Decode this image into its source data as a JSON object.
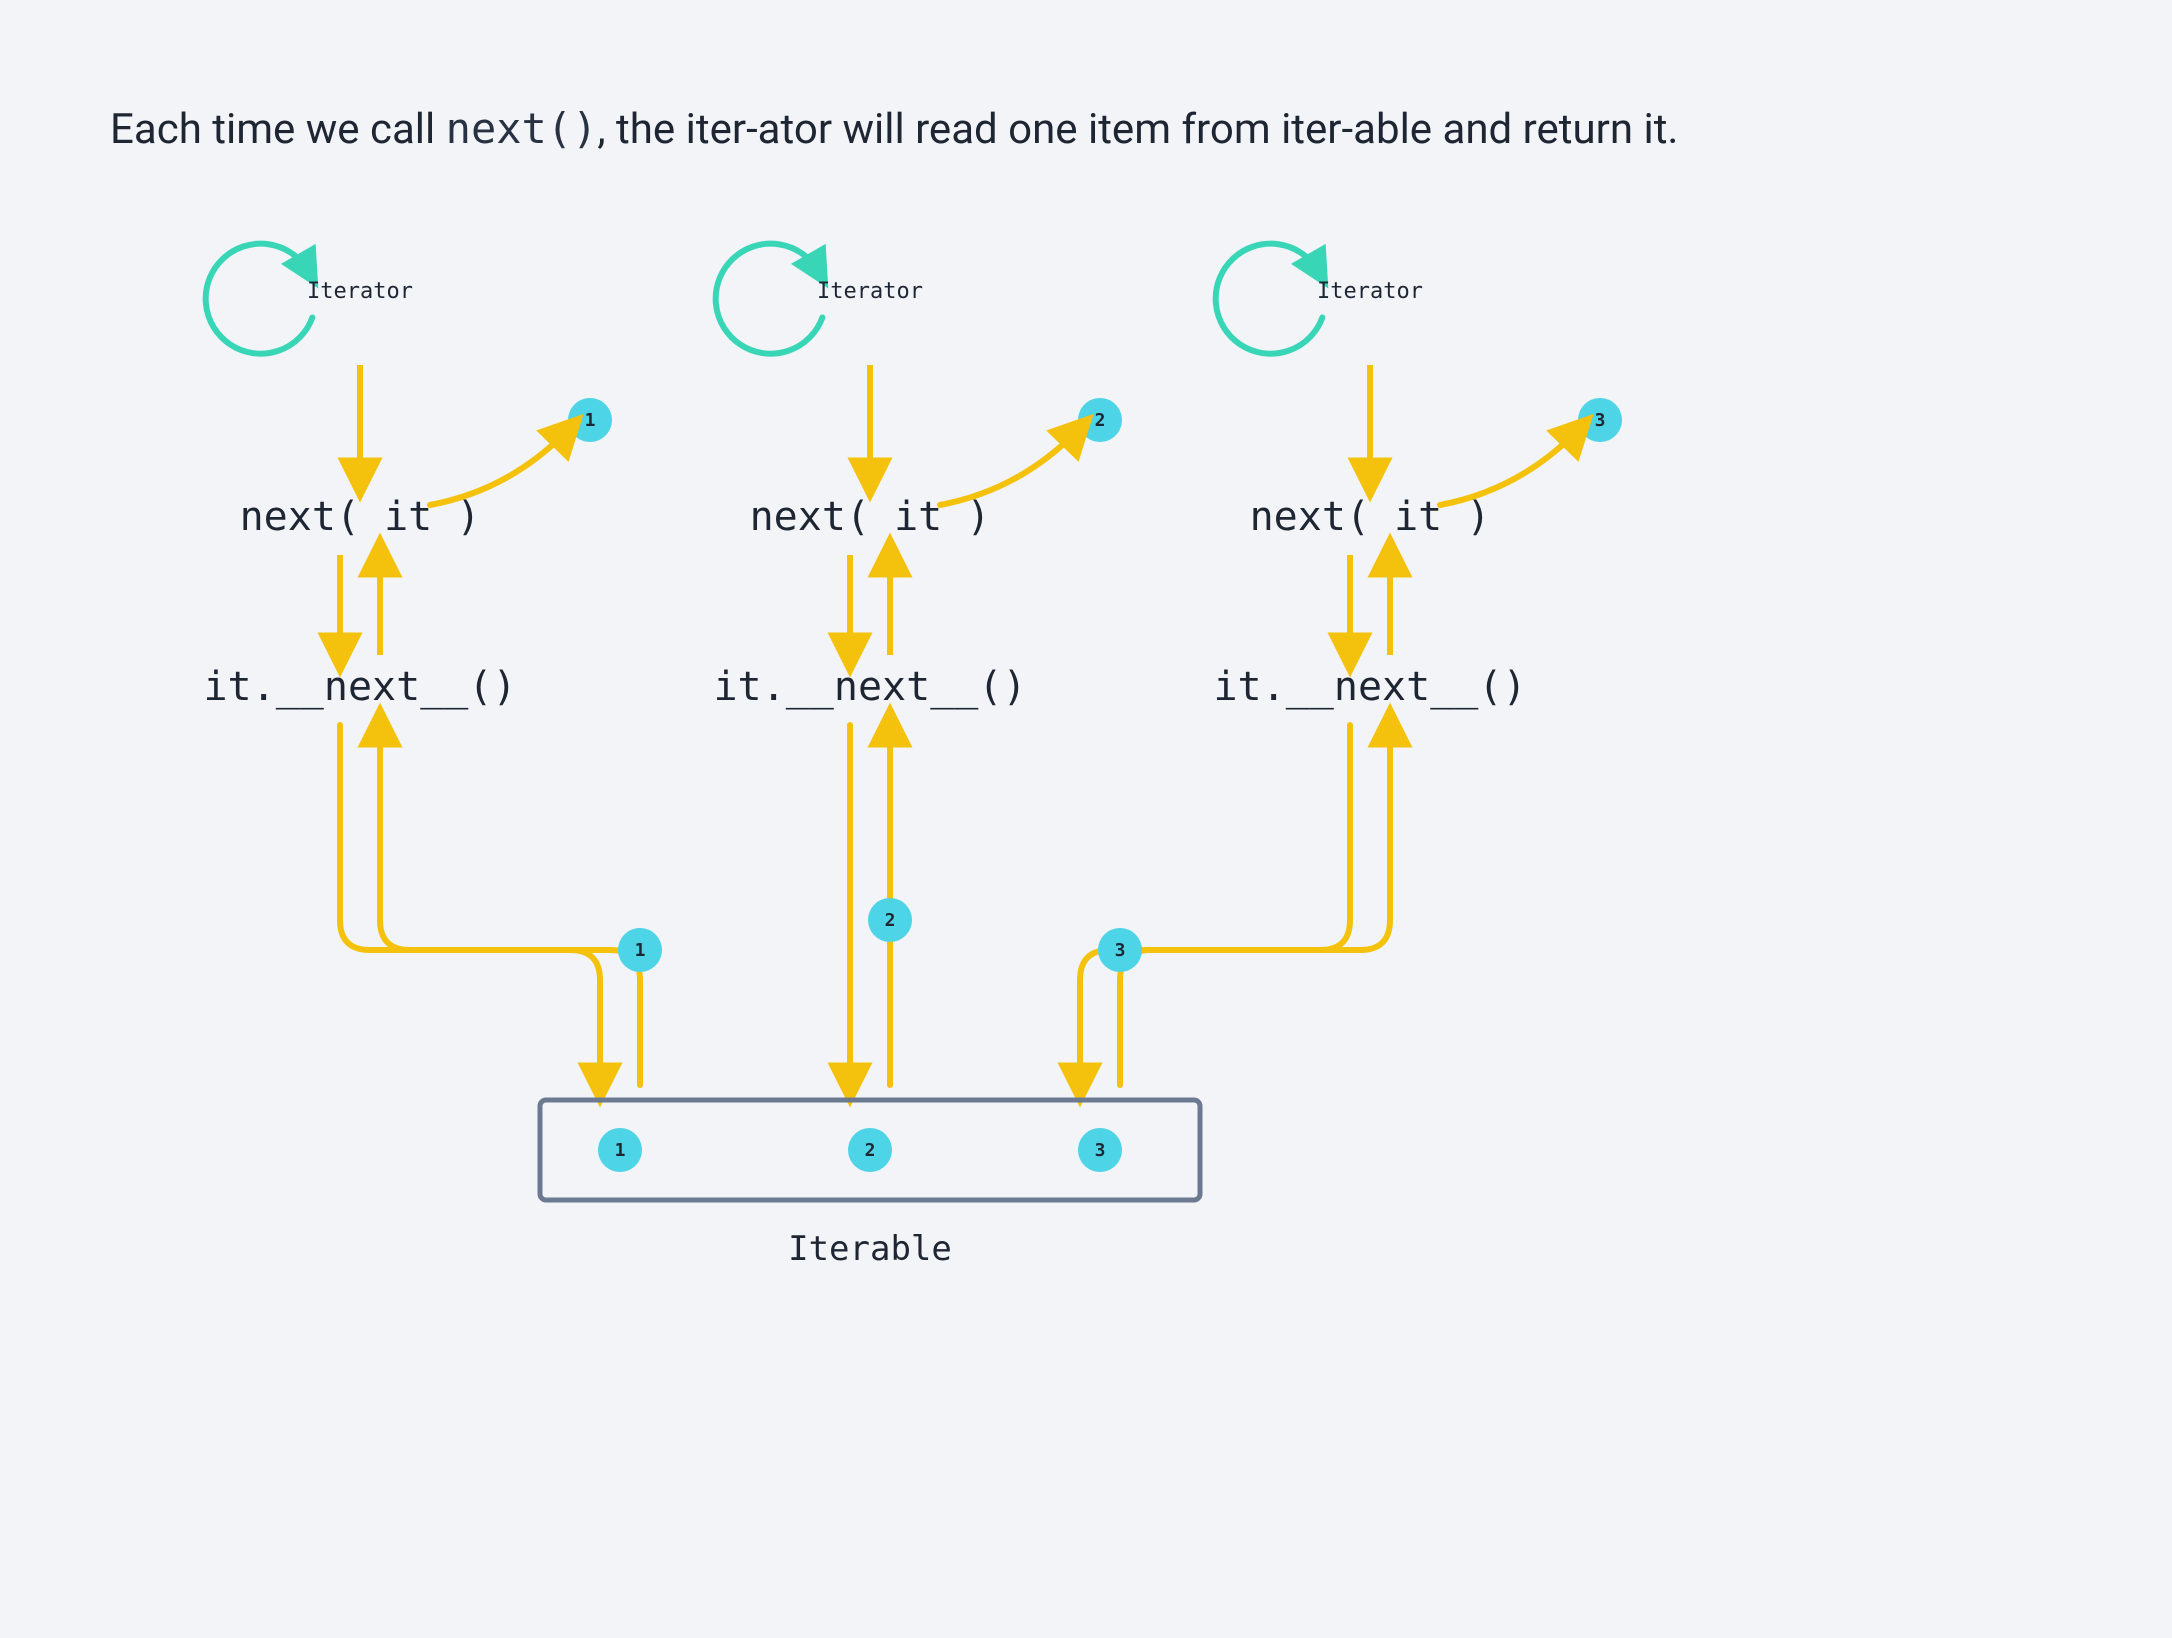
{
  "title_prefix": "Each time we call ",
  "title_code": "next()",
  "title_suffix": ", the iter-ator will read one item from iter-able and return it.",
  "iterator_label": "Iterator",
  "next_call_label": "next( it )",
  "dunder_label": "it.__next__()",
  "iterable_label": "Iterable",
  "columns": [
    {
      "return_value": "1",
      "path_value": "1"
    },
    {
      "return_value": "2",
      "path_value": "2"
    },
    {
      "return_value": "3",
      "path_value": "3"
    }
  ],
  "iterable_items": [
    "1",
    "2",
    "3"
  ],
  "colors": {
    "arrow": "#F4C20D",
    "iterator_ring": "#38D6B7",
    "badge_fill": "#4ED4E7",
    "badge_text": "#1F2633",
    "box_stroke": "#6B7A90",
    "bg": "#F2F4F7",
    "text": "#1F2633"
  }
}
